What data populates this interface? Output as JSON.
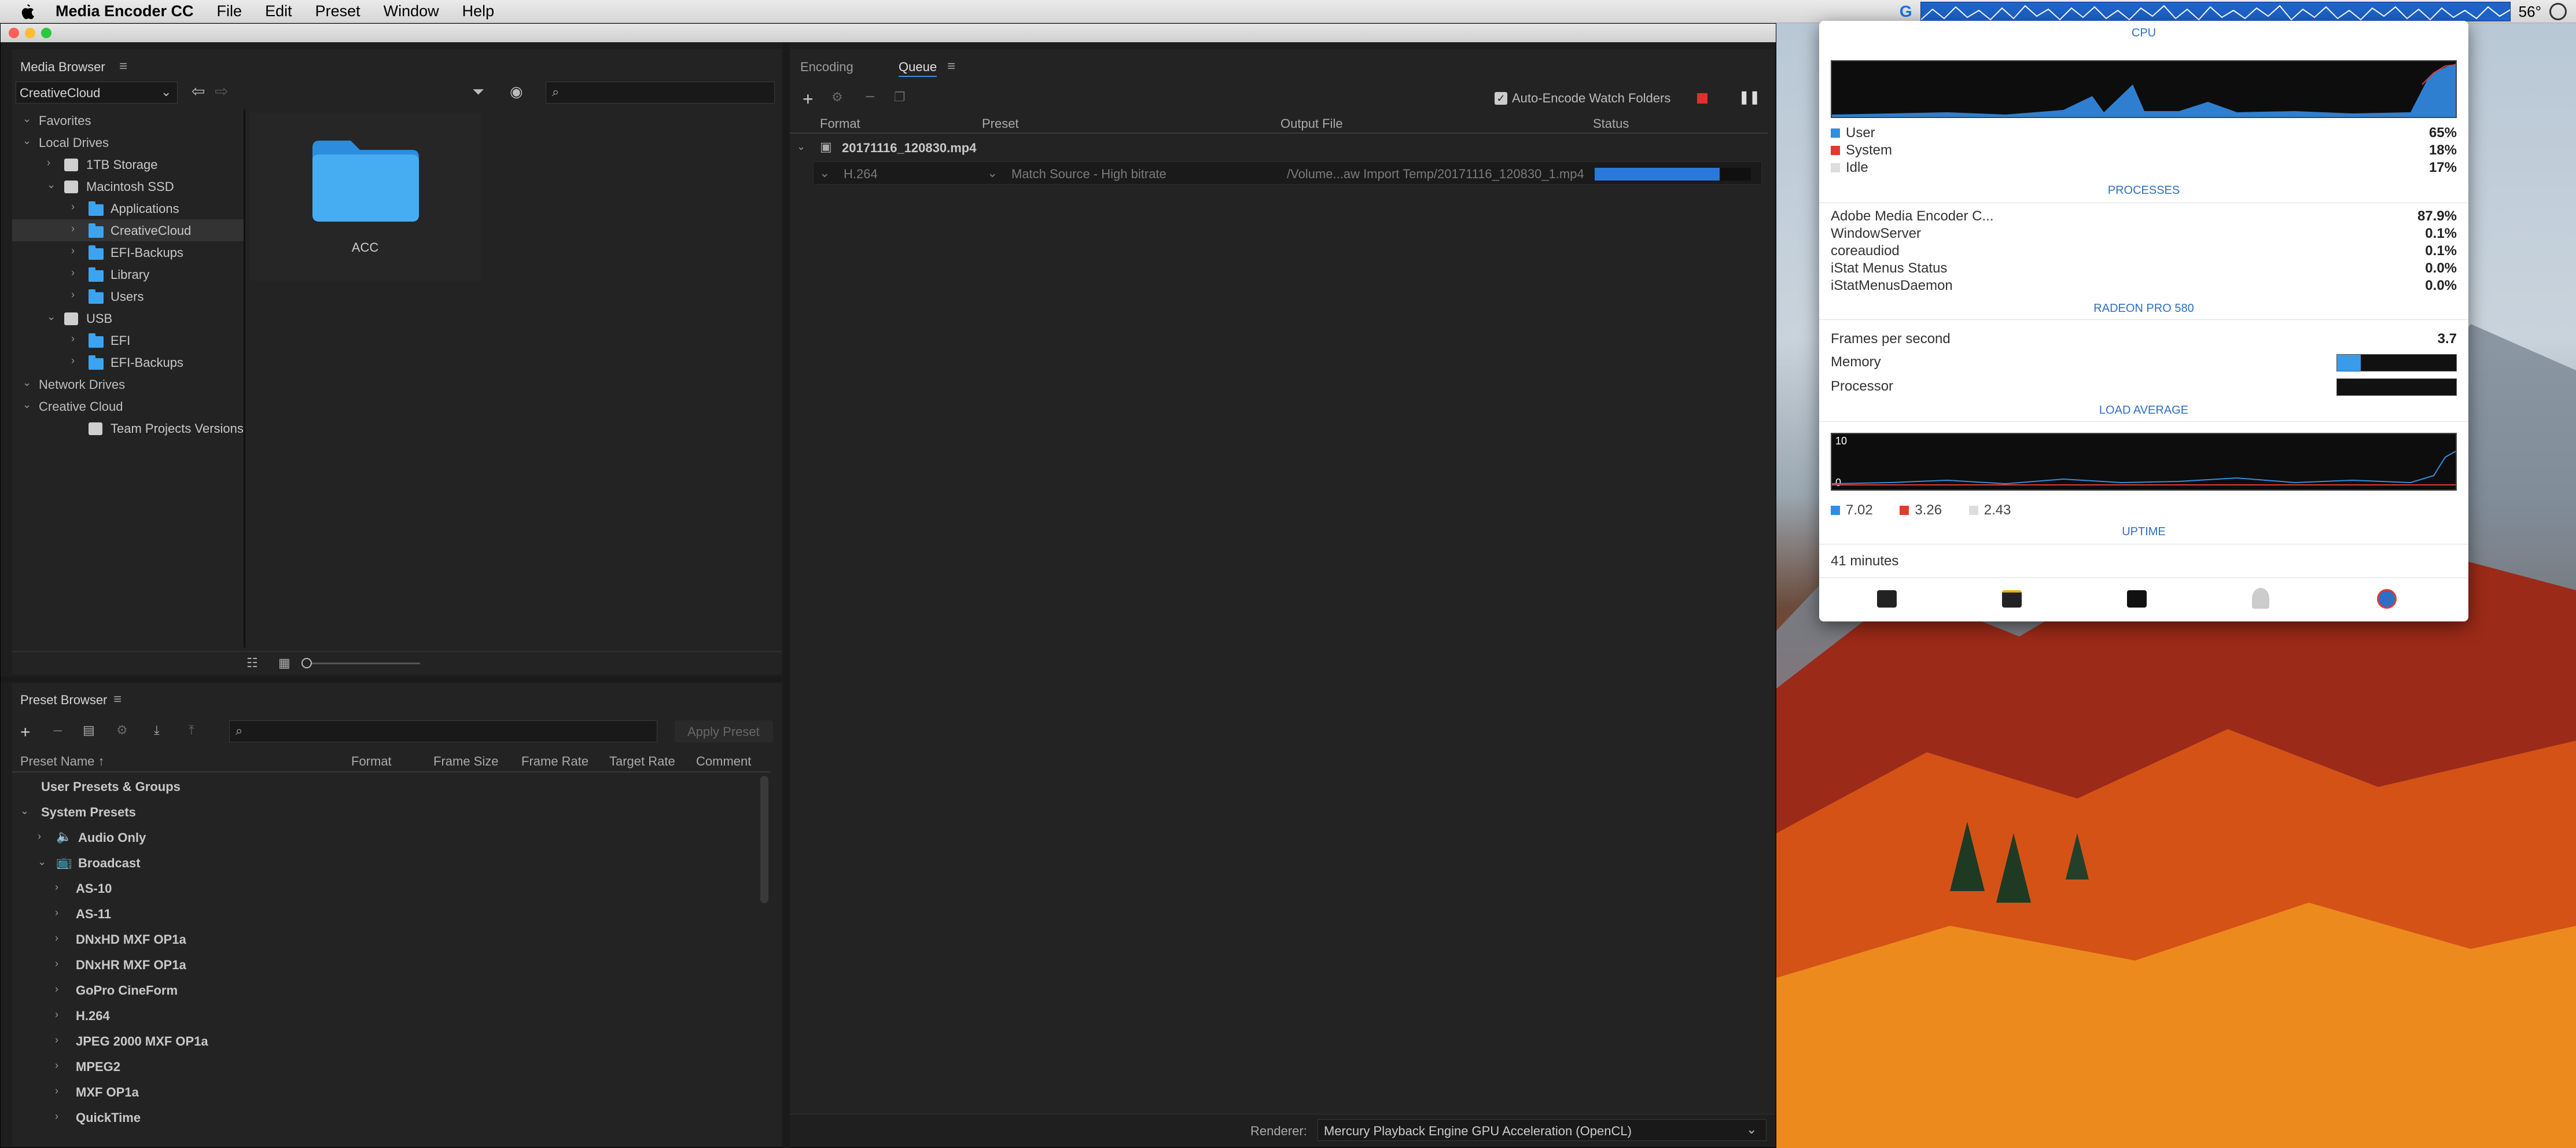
{
  "menubar": {
    "app_name": "Media Encoder CC",
    "items": [
      "File",
      "Edit",
      "Preset",
      "Window",
      "Help"
    ],
    "temperature": "56°"
  },
  "media_browser": {
    "title": "Media Browser",
    "location": "CreativeCloud",
    "tree": [
      {
        "label": "Favorites",
        "level": 0,
        "icon": "none"
      },
      {
        "label": "Local Drives",
        "level": 0,
        "icon": "none"
      },
      {
        "label": "1TB Storage",
        "level": 1,
        "icon": "drive"
      },
      {
        "label": "Macintosh SSD",
        "level": 1,
        "icon": "drive"
      },
      {
        "label": "Applications",
        "level": 2,
        "icon": "folder"
      },
      {
        "label": "CreativeCloud",
        "level": 2,
        "icon": "folder"
      },
      {
        "label": "EFI-Backups",
        "level": 2,
        "icon": "folder"
      },
      {
        "label": "Library",
        "level": 2,
        "icon": "folder"
      },
      {
        "label": "Users",
        "level": 2,
        "icon": "folder"
      },
      {
        "label": "USB",
        "level": 1,
        "icon": "drive"
      },
      {
        "label": "EFI",
        "level": 2,
        "icon": "folder"
      },
      {
        "label": "EFI-Backups",
        "level": 2,
        "icon": "folder"
      },
      {
        "label": "Network Drives",
        "level": 0,
        "icon": "none"
      },
      {
        "label": "Creative Cloud",
        "level": 0,
        "icon": "none"
      },
      {
        "label": "Team Projects Versions",
        "level": 2,
        "icon": "team"
      }
    ],
    "grid_item": "ACC"
  },
  "queue": {
    "tabs": [
      "Encoding",
      "Queue"
    ],
    "active_tab": "Queue",
    "auto_encode_label": "Auto-Encode Watch Folders",
    "columns": [
      "Format",
      "Preset",
      "Output File",
      "Status"
    ],
    "group_name": "20171116_120830.mp4",
    "item": {
      "format": "H.264",
      "preset": "Match Source - High bitrate",
      "output": "/Volume...aw Import Temp/20171116_120830_1.mp4",
      "progress": 0.8
    },
    "renderer_label": "Renderer:",
    "renderer_value": "Mercury Playback Engine GPU Acceleration (OpenCL)"
  },
  "preset_browser": {
    "title": "Preset Browser",
    "apply_label": "Apply Preset",
    "columns": [
      "Preset Name",
      "Format",
      "Frame Size",
      "Frame Rate",
      "Target Rate",
      "Comment"
    ],
    "rows": [
      {
        "label": "User Presets & Groups",
        "level": 0
      },
      {
        "label": "System Presets",
        "level": 0
      },
      {
        "label": "Audio Only",
        "level": 1
      },
      {
        "label": "Broadcast",
        "level": 1
      },
      {
        "label": "AS-10",
        "level": 2
      },
      {
        "label": "AS-11",
        "level": 2
      },
      {
        "label": "DNxHD MXF OP1a",
        "level": 2
      },
      {
        "label": "DNxHR MXF OP1a",
        "level": 2
      },
      {
        "label": "GoPro CineForm",
        "level": 2
      },
      {
        "label": "H.264",
        "level": 2
      },
      {
        "label": "JPEG 2000 MXF OP1a",
        "level": 2
      },
      {
        "label": "MPEG2",
        "level": 2
      },
      {
        "label": "MXF OP1a",
        "level": 2
      },
      {
        "label": "QuickTime",
        "level": 2
      }
    ]
  },
  "istat": {
    "cpu": {
      "title": "CPU",
      "user_label": "User",
      "user": "65%",
      "system_label": "System",
      "system": "18%",
      "idle_label": "Idle",
      "idle": "17%"
    },
    "processes": {
      "title": "PROCESSES",
      "items": [
        {
          "name": "Adobe Media Encoder C...",
          "value": "87.9%"
        },
        {
          "name": "WindowServer",
          "value": "0.1%"
        },
        {
          "name": "coreaudiod",
          "value": "0.1%"
        },
        {
          "name": "iStat Menus Status",
          "value": "0.0%"
        },
        {
          "name": "iStatMenusDaemon",
          "value": "0.0%"
        }
      ]
    },
    "gpu": {
      "title": "RADEON PRO 580",
      "fps_label": "Frames per second",
      "fps": "3.7",
      "memory_label": "Memory",
      "memory": 0.2,
      "processor_label": "Processor",
      "processor": 0.0
    },
    "load": {
      "title": "LOAD AVERAGE",
      "max_label": "10",
      "min_label": "0",
      "values": [
        "7.02",
        "3.26",
        "2.43"
      ]
    },
    "uptime": {
      "title": "UPTIME",
      "value": "41 minutes"
    },
    "colors": {
      "user": "#2f8fde",
      "system": "#e23b2e",
      "idle": "#dddddd",
      "accent": "#2e6ec5"
    }
  }
}
